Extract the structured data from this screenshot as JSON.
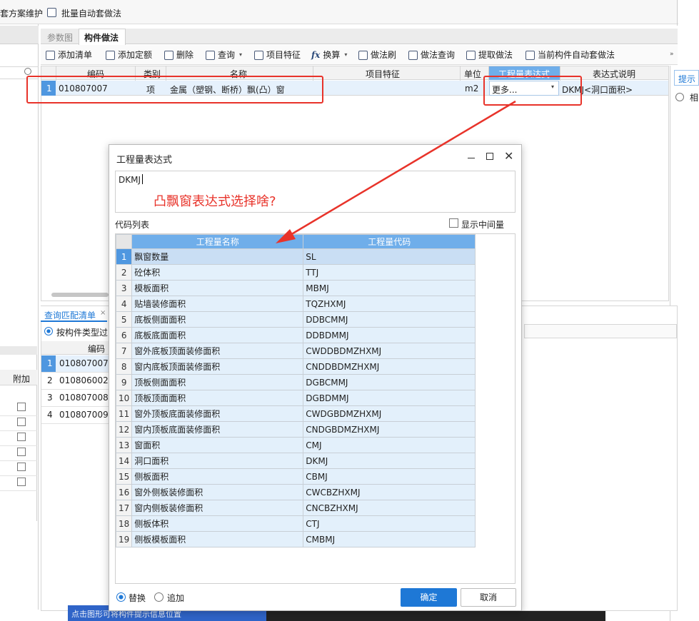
{
  "app": {
    "toolbar_top": {
      "item_scheme": "套方案维护",
      "item_batch": "批量自动套做法"
    }
  },
  "tabs": {
    "tab1": "参数图",
    "tab2": "构件做法"
  },
  "toolbar": {
    "add_list": "添加清单",
    "add_quota": "添加定额",
    "delete": "删除",
    "query": "查询",
    "item_feature": "项目特征",
    "convert": "换算",
    "method_brush": "做法刷",
    "method_query": "做法查询",
    "extract": "提取做法",
    "auto": "当前构件自动套做法"
  },
  "main_grid": {
    "headers": {
      "code": "编码",
      "category": "类别",
      "name": "名称",
      "feature": "项目特征",
      "unit": "单位",
      "expr": "工程量表达式",
      "desc": "表达式说明"
    },
    "row": {
      "index": "1",
      "code": "010807007",
      "category": "项",
      "name": "金属（塑钢、断桥）飘(凸）窗",
      "unit": "m2",
      "expr": "更多...",
      "desc": "DKMJ<洞口面积>"
    }
  },
  "right_panel": {
    "tab": "提示",
    "radio": "相"
  },
  "lower": {
    "tab": "查询匹配清单",
    "radio": "按构件类型过",
    "header_code": "编码",
    "header_attach": "附加",
    "rows": [
      {
        "i": "1",
        "code": "010807007"
      },
      {
        "i": "2",
        "code": "010806002"
      },
      {
        "i": "3",
        "code": "010807008"
      },
      {
        "i": "4",
        "code": "010807009"
      }
    ]
  },
  "status_text": "点击图形可将构件提示信息位置",
  "dialog": {
    "title": "工程量表达式",
    "expression": "DKMJ",
    "annotation": "凸飘窗表达式选择啥?",
    "code_list_label": "代码列表",
    "show_intermediate": "显示中间量",
    "col_name": "工程量名称",
    "col_code": "工程量代码",
    "rows": [
      {
        "i": "1",
        "name": "飘窗数量",
        "code": "SL"
      },
      {
        "i": "2",
        "name": "砼体积",
        "code": "TTJ"
      },
      {
        "i": "3",
        "name": "模板面积",
        "code": "MBMJ"
      },
      {
        "i": "4",
        "name": "贴墙装修面积",
        "code": "TQZHXMJ"
      },
      {
        "i": "5",
        "name": "底板侧面面积",
        "code": "DDBCMMJ"
      },
      {
        "i": "6",
        "name": "底板底面面积",
        "code": "DDBDMMJ"
      },
      {
        "i": "7",
        "name": "窗外底板顶面装修面积",
        "code": "CWDDBDMZHXMJ"
      },
      {
        "i": "8",
        "name": "窗内底板顶面装修面积",
        "code": "CNDDBDMZHXMJ"
      },
      {
        "i": "9",
        "name": "顶板侧面面积",
        "code": "DGBCMMJ"
      },
      {
        "i": "10",
        "name": "顶板顶面面积",
        "code": "DGBDMMJ"
      },
      {
        "i": "11",
        "name": "窗外顶板底面装修面积",
        "code": "CWDGBDMZHXMJ"
      },
      {
        "i": "12",
        "name": "窗内顶板底面装修面积",
        "code": "CNDGBDMZHXMJ"
      },
      {
        "i": "13",
        "name": "窗面积",
        "code": "CMJ"
      },
      {
        "i": "14",
        "name": "洞口面积",
        "code": "DKMJ"
      },
      {
        "i": "15",
        "name": "侧板面积",
        "code": "CBMJ"
      },
      {
        "i": "16",
        "name": "窗外侧板装修面积",
        "code": "CWCBZHXMJ"
      },
      {
        "i": "17",
        "name": "窗内侧板装修面积",
        "code": "CNCBZHXMJ"
      },
      {
        "i": "18",
        "name": "侧板体积",
        "code": "CTJ"
      },
      {
        "i": "19",
        "name": "侧板模板面积",
        "code": "CMBMJ"
      }
    ],
    "radio_replace": "替换",
    "radio_append": "追加",
    "ok": "确定",
    "cancel": "取消"
  },
  "colors": {
    "accent": "#1e78d6",
    "annotation": "#e8332a",
    "header": "#6faeea"
  }
}
